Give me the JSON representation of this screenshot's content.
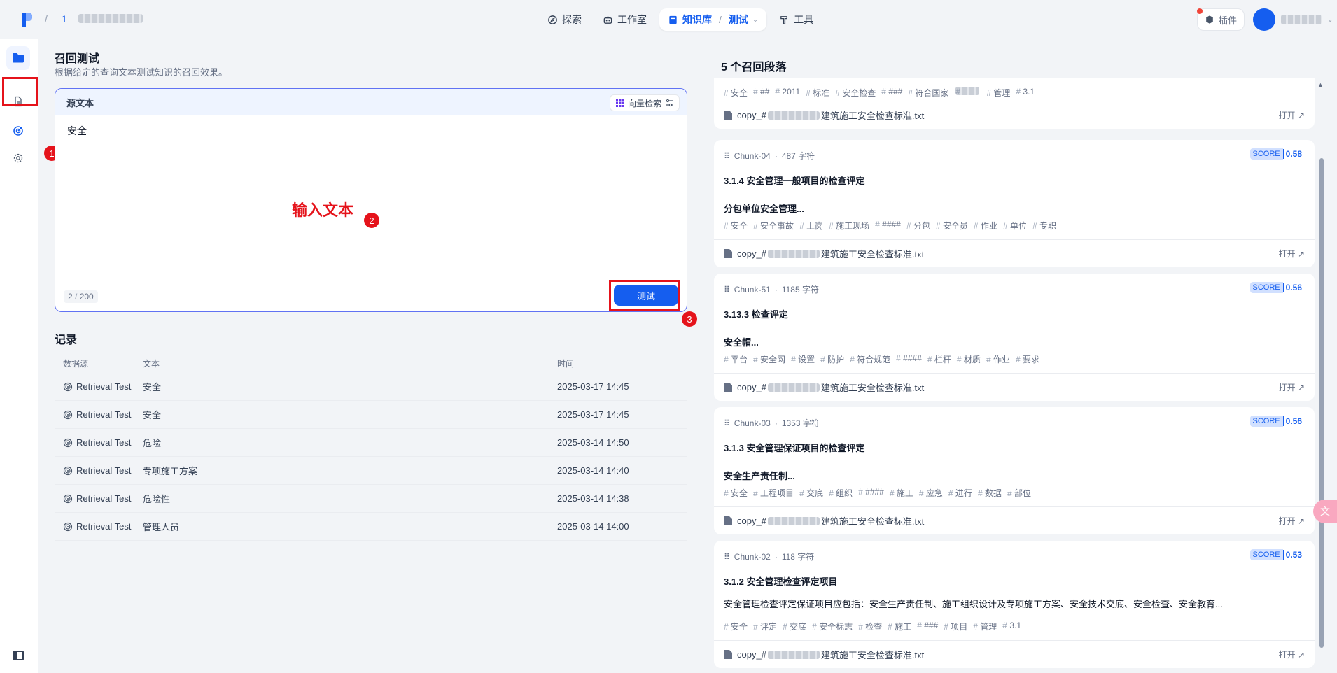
{
  "header": {
    "breadcrumb_num": "1",
    "nav": [
      {
        "label": "探索",
        "icon": "compass-icon"
      },
      {
        "label": "工作室",
        "icon": "robot-icon"
      },
      {
        "label": "知识库",
        "icon": "book-icon",
        "sub": "测试",
        "active": true
      },
      {
        "label": "工具",
        "icon": "hammer-icon"
      }
    ],
    "plugin_label": "插件"
  },
  "page": {
    "title": "召回测试",
    "description": "根据给定的查询文本测试知识的召回效果。",
    "source_label": "源文本",
    "search_mode": "向量检索",
    "query": "安全",
    "char_count": "2",
    "char_limit": "200",
    "test_button": "测试",
    "annotation": "输入文本"
  },
  "badges": [
    "1",
    "2",
    "3"
  ],
  "records": {
    "title": "记录",
    "columns": [
      "数据源",
      "文本",
      "时间"
    ],
    "rows": [
      {
        "source": "Retrieval Test",
        "text": "安全",
        "time": "2025-03-17 14:45"
      },
      {
        "source": "Retrieval Test",
        "text": "安全",
        "time": "2025-03-17 14:45"
      },
      {
        "source": "Retrieval Test",
        "text": "危险",
        "time": "2025-03-14 14:50"
      },
      {
        "source": "Retrieval Test",
        "text": "专项施工方案",
        "time": "2025-03-14 14:40"
      },
      {
        "source": "Retrieval Test",
        "text": "危险性",
        "time": "2025-03-14 14:38"
      },
      {
        "source": "Retrieval Test",
        "text": "管理人员",
        "time": "2025-03-14 14:00"
      }
    ]
  },
  "results": {
    "title": "5 个召回段落",
    "open_label": "打开",
    "file_prefix": "copy_#",
    "file_suffix": "建筑施工安全检查标准.txt",
    "first_tags": [
      "安全",
      "##",
      "2011",
      "标准",
      "安全检查",
      "###",
      "符合国家",
      "管理",
      "3.1"
    ],
    "chunks": [
      {
        "id": "Chunk-04",
        "chars": "487 字符",
        "score_label": "SCORE",
        "score": "0.58",
        "title": "3.1.4 安全管理一般项目的检查评定",
        "body": "分包单位安全管理...",
        "tags": [
          "安全",
          "安全事故",
          "上岗",
          "施工现场",
          "####",
          "分包",
          "安全员",
          "作业",
          "单位",
          "专职"
        ]
      },
      {
        "id": "Chunk-51",
        "chars": "1185 字符",
        "score_label": "SCORE",
        "score": "0.56",
        "title": "3.13.3 检查评定",
        "body": "安全帽...",
        "tags": [
          "平台",
          "安全网",
          "设置",
          "防护",
          "符合规范",
          "####",
          "栏杆",
          "材质",
          "作业",
          "要求"
        ]
      },
      {
        "id": "Chunk-03",
        "chars": "1353 字符",
        "score_label": "SCORE",
        "score": "0.56",
        "title": "3.1.3 安全管理保证项目的检查评定",
        "body": "安全生产责任制...",
        "tags": [
          "安全",
          "工程项目",
          "交底",
          "组织",
          "####",
          "施工",
          "应急",
          "进行",
          "数据",
          "部位"
        ]
      },
      {
        "id": "Chunk-02",
        "chars": "118 字符",
        "score_label": "SCORE",
        "score": "0.53",
        "title": "3.1.2 安全管理检查评定项目",
        "body": "安全管理检查评定保证项目应包括：安全生产责任制、施工组织设计及专项施工方案、安全技术交底、安全检查、安全教育...",
        "tags": [
          "安全",
          "评定",
          "交底",
          "安全标志",
          "检查",
          "施工",
          "###",
          "项目",
          "管理",
          "3.1"
        ]
      }
    ]
  },
  "colors": {
    "accent": "#155eef",
    "annotation_red": "#e5131b",
    "border_focus": "#6172f3"
  }
}
